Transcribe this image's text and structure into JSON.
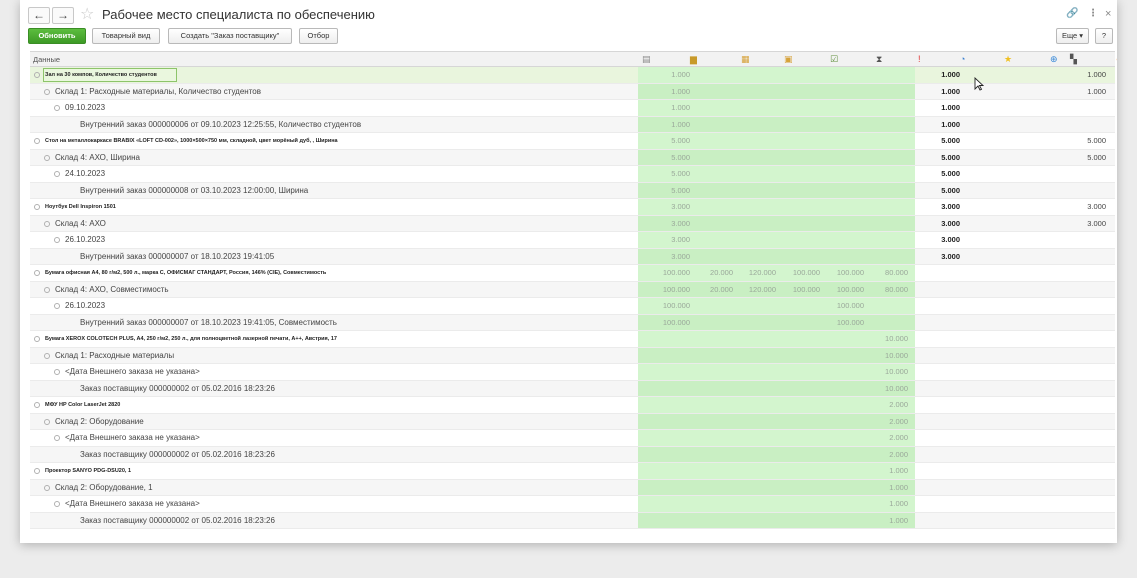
{
  "window": {
    "title": "Рабочее место специалиста по обеспечению",
    "nav_back": "←",
    "nav_forward": "→",
    "favorite_glyph": "☆",
    "link_glyph": "🔗",
    "more_glyph": "⋮",
    "close_glyph": "×"
  },
  "toolbar": {
    "refresh": "Обновить",
    "goods_view": "Товарный вид",
    "create_order": "Создать \"Заказ поставщику\"",
    "filter": "Отбор",
    "more": "Еще ▾",
    "help": "?"
  },
  "grid": {
    "data_header": "Данные",
    "icons": [
      {
        "name": "document-icon",
        "glyph": "▤",
        "color": "#8a8a8a"
      },
      {
        "name": "truck-loaded-icon",
        "glyph": "▆",
        "color": "#c89a2a"
      },
      {
        "name": "box-icon",
        "glyph": "▦",
        "color": "#d6a23a"
      },
      {
        "name": "boxes-icon",
        "glyph": "▣",
        "color": "#d6a23a"
      },
      {
        "name": "checklist-icon",
        "glyph": "☑",
        "color": "#5d8f3a"
      },
      {
        "name": "hourglass-icon",
        "glyph": "⧗",
        "color": "#555555"
      },
      {
        "name": "exclamation-icon",
        "glyph": "!",
        "color": "#e03030"
      },
      {
        "name": "pie-chart-icon",
        "glyph": "◔",
        "color": "#3a7fd0"
      },
      {
        "name": "star-icon",
        "glyph": "★",
        "color": "#f0c020"
      },
      {
        "name": "plus-circle-icon",
        "glyph": "⊕",
        "color": "#3a8ad8"
      },
      {
        "name": "forklift-icon",
        "glyph": "▚",
        "color": "#555555"
      },
      {
        "name": "orange-circle-icon",
        "glyph": "●",
        "color": "#f08a30"
      }
    ],
    "rows": [
      {
        "label": "Зал на 30 компов, Количество студентов",
        "level": 0,
        "num": [
          "1.000",
          "",
          "",
          "",
          "",
          "",
          "1.000"
        ],
        "right": "1.000",
        "chk": true
      },
      {
        "label": "Склад 1: Расходные материалы, Количество студентов",
        "level": 1,
        "num": [
          "1.000",
          "",
          "",
          "",
          "",
          "",
          "1.000"
        ],
        "right": "1.000",
        "chk": true
      },
      {
        "label": "09.10.2023",
        "level": 2,
        "num": [
          "1.000",
          "",
          "",
          "",
          "",
          "",
          "1.000"
        ],
        "right": "",
        "chk": false
      },
      {
        "label": "Внутренний заказ 000000006 от 09.10.2023 12:25:55, Количество студентов",
        "level": 3,
        "num": [
          "1.000",
          "",
          "",
          "",
          "",
          "",
          "1.000"
        ],
        "right": "",
        "chk": false
      },
      {
        "label": "Стол на металлокаркасе BRABIX «LOFT CD-002», 1000×500×750 мм, складной, цвет морёный дуб, , Ширина",
        "level": 0,
        "num": [
          "5.000",
          "",
          "",
          "",
          "",
          "",
          "5.000"
        ],
        "right": "5.000",
        "chk": true
      },
      {
        "label": "Склад 4: АХО, Ширина",
        "level": 1,
        "num": [
          "5.000",
          "",
          "",
          "",
          "",
          "",
          "5.000"
        ],
        "right": "5.000",
        "chk": true
      },
      {
        "label": "24.10.2023",
        "level": 2,
        "num": [
          "5.000",
          "",
          "",
          "",
          "",
          "",
          "5.000"
        ],
        "right": "",
        "chk": false
      },
      {
        "label": "Внутренний заказ 000000008 от 03.10.2023 12:00:00, Ширина",
        "level": 3,
        "num": [
          "5.000",
          "",
          "",
          "",
          "",
          "",
          "5.000"
        ],
        "right": "",
        "chk": false
      },
      {
        "label": "Ноутбук Dell Inspiron 1501",
        "level": 0,
        "num": [
          "3.000",
          "",
          "",
          "",
          "",
          "",
          "3.000"
        ],
        "right": "3.000",
        "chk": true
      },
      {
        "label": "Склад 4: АХО",
        "level": 1,
        "num": [
          "3.000",
          "",
          "",
          "",
          "",
          "",
          "3.000"
        ],
        "right": "3.000",
        "chk": true
      },
      {
        "label": "26.10.2023",
        "level": 2,
        "num": [
          "3.000",
          "",
          "",
          "",
          "",
          "",
          "3.000"
        ],
        "right": "",
        "chk": false
      },
      {
        "label": "Внутренний заказ 000000007 от 18.10.2023 19:41:05",
        "level": 3,
        "num": [
          "3.000",
          "",
          "",
          "",
          "",
          "",
          "3.000"
        ],
        "right": "",
        "chk": false
      },
      {
        "label": "Бумага офисная A4, 80 г/м2, 500 л., марка С, ОФИСМАГ СТАНДАРТ, Россия, 146% (CIE), Совместимость",
        "level": 0,
        "num": [
          "100.000",
          "20.000",
          "120.000",
          "100.000",
          "100.000",
          "80.000",
          ""
        ],
        "right": "",
        "chk": true
      },
      {
        "label": "Склад 4: АХО, Совместимость",
        "level": 1,
        "num": [
          "100.000",
          "20.000",
          "120.000",
          "100.000",
          "100.000",
          "80.000",
          ""
        ],
        "right": "",
        "chk": true
      },
      {
        "label": "26.10.2023",
        "level": 2,
        "num": [
          "100.000",
          "",
          "",
          "",
          "100.000",
          "",
          ""
        ],
        "right": "",
        "chk": false
      },
      {
        "label": "Внутренний заказ 000000007 от 18.10.2023 19:41:05, Совместимость",
        "level": 3,
        "num": [
          "100.000",
          "",
          "",
          "",
          "100.000",
          "",
          ""
        ],
        "right": "",
        "chk": false
      },
      {
        "label": "Бумага XEROX COLOTECH PLUS, A4, 250 г/м2, 250 л., для полноцветной лазерной печати, А++, Австрия, 17",
        "level": 0,
        "num": [
          "",
          "",
          "",
          "",
          "",
          "10.000",
          ""
        ],
        "right": "",
        "chk": false
      },
      {
        "label": "Склад 1: Расходные материалы",
        "level": 1,
        "num": [
          "",
          "",
          "",
          "",
          "",
          "10.000",
          ""
        ],
        "right": "",
        "chk": false
      },
      {
        "label": "<Дата Внешнего заказа не указана>",
        "level": 2,
        "num": [
          "",
          "",
          "",
          "",
          "",
          "10.000",
          ""
        ],
        "right": "",
        "chk": false
      },
      {
        "label": "Заказ поставщику 000000002 от 05.02.2016 18:23:26",
        "level": 3,
        "num": [
          "",
          "",
          "",
          "",
          "",
          "10.000",
          ""
        ],
        "right": "",
        "chk": false
      },
      {
        "label": "МФУ HP Color LaserJet 2820",
        "level": 0,
        "num": [
          "",
          "",
          "",
          "",
          "",
          "2.000",
          ""
        ],
        "right": "",
        "chk": false
      },
      {
        "label": "Склад 2: Оборудование",
        "level": 1,
        "num": [
          "",
          "",
          "",
          "",
          "",
          "2.000",
          ""
        ],
        "right": "",
        "chk": false
      },
      {
        "label": "<Дата Внешнего заказа не указана>",
        "level": 2,
        "num": [
          "",
          "",
          "",
          "",
          "",
          "2.000",
          ""
        ],
        "right": "",
        "chk": false
      },
      {
        "label": "Заказ поставщику 000000002 от 05.02.2016 18:23:26",
        "level": 3,
        "num": [
          "",
          "",
          "",
          "",
          "",
          "2.000",
          ""
        ],
        "right": "",
        "chk": false
      },
      {
        "label": "Проектор SANYO PDG-DSU20, 1",
        "level": 0,
        "num": [
          "",
          "",
          "",
          "",
          "",
          "1.000",
          ""
        ],
        "right": "",
        "chk": false
      },
      {
        "label": "Склад 2: Оборудование, 1",
        "level": 1,
        "num": [
          "",
          "",
          "",
          "",
          "",
          "1.000",
          ""
        ],
        "right": "",
        "chk": false
      },
      {
        "label": "<Дата Внешнего заказа не указана>",
        "level": 2,
        "num": [
          "",
          "",
          "",
          "",
          "",
          "1.000",
          ""
        ],
        "right": "",
        "chk": false
      },
      {
        "label": "Заказ поставщику 000000002 от 05.02.2016 18:23:26",
        "level": 3,
        "num": [
          "",
          "",
          "",
          "",
          "",
          "1.000",
          ""
        ],
        "right": "",
        "chk": false
      }
    ]
  }
}
